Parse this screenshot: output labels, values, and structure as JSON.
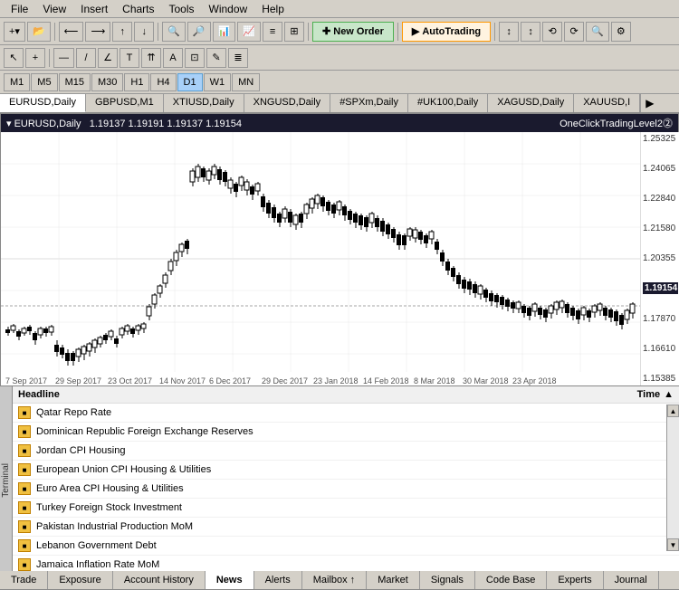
{
  "menubar": {
    "items": [
      "File",
      "View",
      "Insert",
      "Charts",
      "Tools",
      "Window",
      "Help"
    ]
  },
  "toolbar1": {
    "buttons": [
      "+",
      "←",
      "→",
      "↑",
      "↓",
      "🔍",
      "🔎",
      "⬜",
      "⬛",
      "📊"
    ]
  },
  "new_order": "New Order",
  "autotrading": "AutoTrading",
  "timeframes": [
    "M1",
    "M5",
    "M15",
    "M30",
    "H1",
    "H4",
    "D1",
    "W1",
    "MN"
  ],
  "active_tf": "D1",
  "chart": {
    "symbol": "EURUSD,Daily",
    "ohlc": "1.19137  1.19191  1.19137  1.19154",
    "indicator": "OneClickTradingLevel2⓶",
    "price_levels": [
      "1.25325",
      "1.24065",
      "1.22840",
      "1.21580",
      "1.20355",
      "1.19154",
      "1.17870",
      "1.16610",
      "1.15385"
    ],
    "time_labels": [
      "7 Sep 2017",
      "29 Sep 2017",
      "23 Oct 2017",
      "14 Nov 2017",
      "6 Dec 2017",
      "29 Dec 2017",
      "23 Jan 2018",
      "14 Feb 2018",
      "8 Mar 2018",
      "30 Mar 2018",
      "23 Apr 2018"
    ]
  },
  "chart_tabs": [
    {
      "label": "EURUSD,Daily",
      "active": true
    },
    {
      "label": "GBPUSD,M1",
      "active": false
    },
    {
      "label": "XTIUSD,Daily",
      "active": false
    },
    {
      "label": "XNGUSD,Daily",
      "active": false
    },
    {
      "label": "#SPXm,Daily",
      "active": false
    },
    {
      "label": "#UK100,Daily",
      "active": false
    },
    {
      "label": "XAGUSD,Daily",
      "active": false
    },
    {
      "label": "XAUUSD,I",
      "active": false
    }
  ],
  "news_header": {
    "headline": "Headline",
    "time": "Time"
  },
  "news_items": [
    "Qatar Repo Rate",
    "Dominican Republic Foreign Exchange Reserves",
    "Jordan CPI Housing",
    "European Union CPI Housing & Utilities",
    "Euro Area CPI Housing & Utilities",
    "Turkey Foreign Stock Investment",
    "Pakistan Industrial Production MoM",
    "Lebanon Government Debt",
    "Jamaica Inflation Rate MoM"
  ],
  "bottom_tabs": [
    "Trade",
    "Exposure",
    "Account History",
    "News",
    "Alerts",
    "Mailbox ↑",
    "Market",
    "Signals",
    "Code Base",
    "Experts",
    "Journal"
  ],
  "active_tab": "News",
  "terminal_label": "Terminal"
}
